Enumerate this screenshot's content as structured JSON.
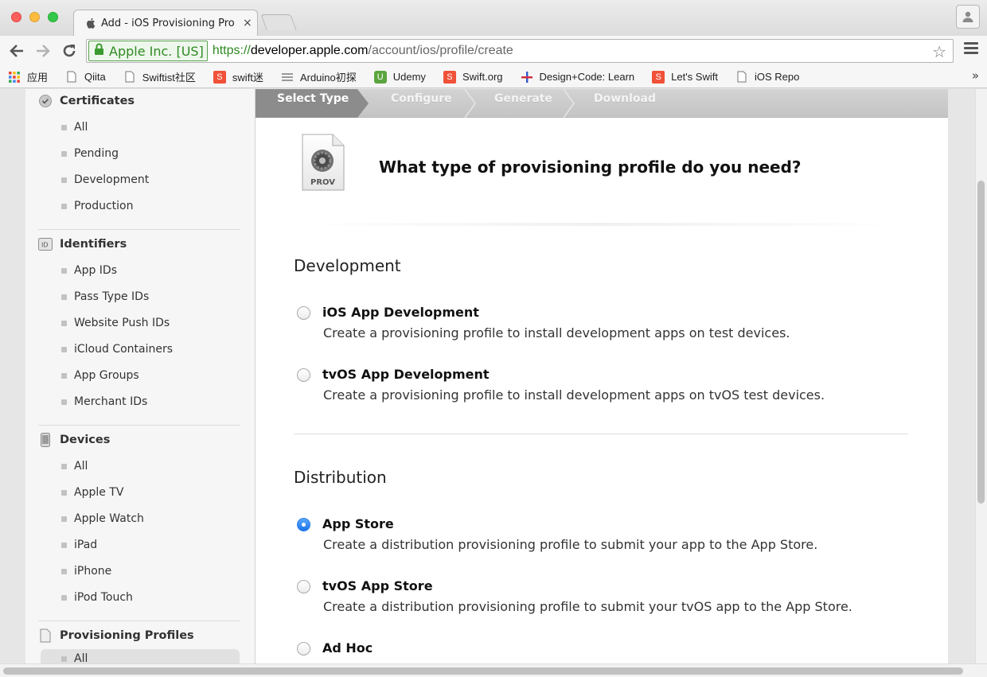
{
  "browser": {
    "tab_title": "Add - iOS Provisioning Pro",
    "tab_close": "×",
    "ev_name": "Apple Inc. [US]",
    "url_scheme": "https://",
    "url_host": "developer.apple.com",
    "url_path": "/account/ios/profile/create",
    "bookmarks": [
      {
        "label": "应用",
        "icon": "apps-grid-icon"
      },
      {
        "label": "Qiita",
        "icon": "page-icon"
      },
      {
        "label": "Swiftist社区",
        "icon": "page-icon"
      },
      {
        "label": "swift迷",
        "icon": "swift-icon"
      },
      {
        "label": "Arduino初探",
        "icon": "list-icon"
      },
      {
        "label": "Udemy",
        "icon": "udemy-icon"
      },
      {
        "label": "Swift.org",
        "icon": "swift-icon"
      },
      {
        "label": "Design+Code: Learn",
        "icon": "plus-icon"
      },
      {
        "label": "Let's Swift",
        "icon": "swift-icon"
      },
      {
        "label": "iOS Repo",
        "icon": "page-icon"
      }
    ],
    "bookmarks_more": "»"
  },
  "sidebar": {
    "certificates": {
      "title": "Certificates",
      "items": [
        "All",
        "Pending",
        "Development",
        "Production"
      ]
    },
    "identifiers": {
      "title": "Identifiers",
      "items": [
        "App IDs",
        "Pass Type IDs",
        "Website Push IDs",
        "iCloud Containers",
        "App Groups",
        "Merchant IDs"
      ]
    },
    "devices": {
      "title": "Devices",
      "items": [
        "All",
        "Apple TV",
        "Apple Watch",
        "iPad",
        "iPhone",
        "iPod Touch"
      ]
    },
    "profiles": {
      "title": "Provisioning Profiles",
      "items": [
        "All"
      ]
    }
  },
  "steps": [
    "Select Type",
    "Configure",
    "Generate",
    "Download"
  ],
  "prov_icon_label": "PROV",
  "question": "What type of provisioning profile do you need?",
  "development": {
    "title": "Development",
    "options": [
      {
        "title": "iOS App Development",
        "desc": "Create a provisioning profile to install development apps on test devices."
      },
      {
        "title": "tvOS App Development",
        "desc": "Create a provisioning profile to install development apps on tvOS test devices."
      }
    ]
  },
  "distribution": {
    "title": "Distribution",
    "options": [
      {
        "title": "App Store",
        "desc": "Create a distribution provisioning profile to submit your app to the App Store.",
        "selected": true
      },
      {
        "title": "tvOS App Store",
        "desc": "Create a distribution provisioning profile to submit your tvOS app to the App Store."
      },
      {
        "title": "Ad Hoc",
        "desc": ""
      }
    ]
  },
  "colors": {
    "accent": "#2d7fe6",
    "ev_green": "#2f8a23",
    "active_step": "#8c8c8c"
  }
}
